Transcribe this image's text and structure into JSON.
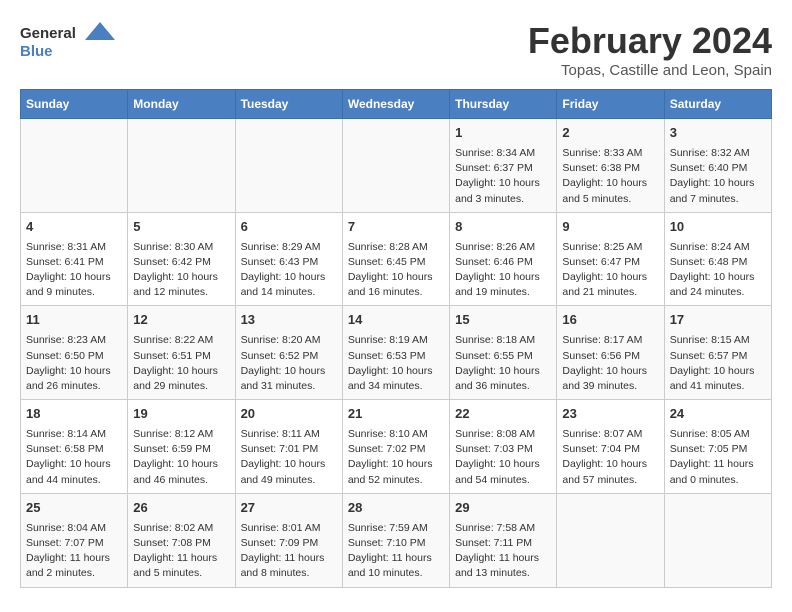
{
  "header": {
    "logo_general": "General",
    "logo_blue": "Blue",
    "main_title": "February 2024",
    "sub_title": "Topas, Castille and Leon, Spain"
  },
  "days_of_week": [
    "Sunday",
    "Monday",
    "Tuesday",
    "Wednesday",
    "Thursday",
    "Friday",
    "Saturday"
  ],
  "weeks": [
    [
      {
        "day": "",
        "content": ""
      },
      {
        "day": "",
        "content": ""
      },
      {
        "day": "",
        "content": ""
      },
      {
        "day": "",
        "content": ""
      },
      {
        "day": "1",
        "content": "Sunrise: 8:34 AM\nSunset: 6:37 PM\nDaylight: 10 hours\nand 3 minutes."
      },
      {
        "day": "2",
        "content": "Sunrise: 8:33 AM\nSunset: 6:38 PM\nDaylight: 10 hours\nand 5 minutes."
      },
      {
        "day": "3",
        "content": "Sunrise: 8:32 AM\nSunset: 6:40 PM\nDaylight: 10 hours\nand 7 minutes."
      }
    ],
    [
      {
        "day": "4",
        "content": "Sunrise: 8:31 AM\nSunset: 6:41 PM\nDaylight: 10 hours\nand 9 minutes."
      },
      {
        "day": "5",
        "content": "Sunrise: 8:30 AM\nSunset: 6:42 PM\nDaylight: 10 hours\nand 12 minutes."
      },
      {
        "day": "6",
        "content": "Sunrise: 8:29 AM\nSunset: 6:43 PM\nDaylight: 10 hours\nand 14 minutes."
      },
      {
        "day": "7",
        "content": "Sunrise: 8:28 AM\nSunset: 6:45 PM\nDaylight: 10 hours\nand 16 minutes."
      },
      {
        "day": "8",
        "content": "Sunrise: 8:26 AM\nSunset: 6:46 PM\nDaylight: 10 hours\nand 19 minutes."
      },
      {
        "day": "9",
        "content": "Sunrise: 8:25 AM\nSunset: 6:47 PM\nDaylight: 10 hours\nand 21 minutes."
      },
      {
        "day": "10",
        "content": "Sunrise: 8:24 AM\nSunset: 6:48 PM\nDaylight: 10 hours\nand 24 minutes."
      }
    ],
    [
      {
        "day": "11",
        "content": "Sunrise: 8:23 AM\nSunset: 6:50 PM\nDaylight: 10 hours\nand 26 minutes."
      },
      {
        "day": "12",
        "content": "Sunrise: 8:22 AM\nSunset: 6:51 PM\nDaylight: 10 hours\nand 29 minutes."
      },
      {
        "day": "13",
        "content": "Sunrise: 8:20 AM\nSunset: 6:52 PM\nDaylight: 10 hours\nand 31 minutes."
      },
      {
        "day": "14",
        "content": "Sunrise: 8:19 AM\nSunset: 6:53 PM\nDaylight: 10 hours\nand 34 minutes."
      },
      {
        "day": "15",
        "content": "Sunrise: 8:18 AM\nSunset: 6:55 PM\nDaylight: 10 hours\nand 36 minutes."
      },
      {
        "day": "16",
        "content": "Sunrise: 8:17 AM\nSunset: 6:56 PM\nDaylight: 10 hours\nand 39 minutes."
      },
      {
        "day": "17",
        "content": "Sunrise: 8:15 AM\nSunset: 6:57 PM\nDaylight: 10 hours\nand 41 minutes."
      }
    ],
    [
      {
        "day": "18",
        "content": "Sunrise: 8:14 AM\nSunset: 6:58 PM\nDaylight: 10 hours\nand 44 minutes."
      },
      {
        "day": "19",
        "content": "Sunrise: 8:12 AM\nSunset: 6:59 PM\nDaylight: 10 hours\nand 46 minutes."
      },
      {
        "day": "20",
        "content": "Sunrise: 8:11 AM\nSunset: 7:01 PM\nDaylight: 10 hours\nand 49 minutes."
      },
      {
        "day": "21",
        "content": "Sunrise: 8:10 AM\nSunset: 7:02 PM\nDaylight: 10 hours\nand 52 minutes."
      },
      {
        "day": "22",
        "content": "Sunrise: 8:08 AM\nSunset: 7:03 PM\nDaylight: 10 hours\nand 54 minutes."
      },
      {
        "day": "23",
        "content": "Sunrise: 8:07 AM\nSunset: 7:04 PM\nDaylight: 10 hours\nand 57 minutes."
      },
      {
        "day": "24",
        "content": "Sunrise: 8:05 AM\nSunset: 7:05 PM\nDaylight: 11 hours\nand 0 minutes."
      }
    ],
    [
      {
        "day": "25",
        "content": "Sunrise: 8:04 AM\nSunset: 7:07 PM\nDaylight: 11 hours\nand 2 minutes."
      },
      {
        "day": "26",
        "content": "Sunrise: 8:02 AM\nSunset: 7:08 PM\nDaylight: 11 hours\nand 5 minutes."
      },
      {
        "day": "27",
        "content": "Sunrise: 8:01 AM\nSunset: 7:09 PM\nDaylight: 11 hours\nand 8 minutes."
      },
      {
        "day": "28",
        "content": "Sunrise: 7:59 AM\nSunset: 7:10 PM\nDaylight: 11 hours\nand 10 minutes."
      },
      {
        "day": "29",
        "content": "Sunrise: 7:58 AM\nSunset: 7:11 PM\nDaylight: 11 hours\nand 13 minutes."
      },
      {
        "day": "",
        "content": ""
      },
      {
        "day": "",
        "content": ""
      }
    ]
  ]
}
